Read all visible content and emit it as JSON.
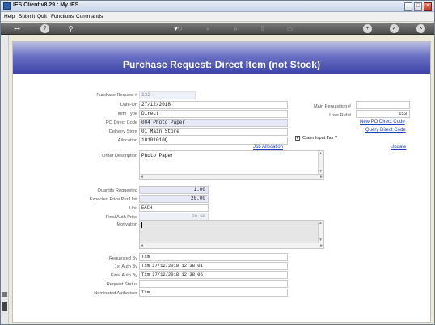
{
  "window": {
    "title": "IES Client v8.29 : My IES",
    "controls": {
      "minimize": "–",
      "maximize": "□",
      "close": "×"
    }
  },
  "menu": [
    "Help",
    "Submit",
    "Quit",
    "Functions",
    "Commands"
  ],
  "toolbar": {
    "icons": [
      "key-icon",
      "help-icon",
      "search-icon",
      "heart-icon",
      "refresh-icon",
      "rewind-icon",
      "forward-icon",
      "upload-icon",
      "page-icon",
      "add-icon",
      "ok-icon",
      "close-icon"
    ],
    "glyphs": {
      "key": "⊶",
      "help": "?",
      "search": "⚲",
      "heart": "♥",
      "refresh": "↻",
      "rewind": "«",
      "forward": "»",
      "upload": "⇧",
      "page": "▭",
      "add": "+",
      "ok": "✓",
      "close": "×"
    }
  },
  "page": {
    "title": "Purchase Request: Direct Item (not Stock)",
    "colors": {
      "banner_top": "#b9bde3",
      "banner_bottom": "#3e44a5",
      "link": "#1a3fbf"
    }
  },
  "form": {
    "purchase_request_no": {
      "label": "Purchase Request #",
      "value": "132"
    },
    "date_on": {
      "label": "Date-On",
      "value": "27/12/2018"
    },
    "item_type": {
      "label": "Item Type",
      "value": "Direct"
    },
    "po_direct_code": {
      "label": "PO Direct Code",
      "value": "004 Photo Paper"
    },
    "delivery_store": {
      "label": "Delivery Store",
      "value": "01 Main Store"
    },
    "allocation": {
      "label": "Allocation",
      "value": "10101010Q"
    },
    "main_requisition": {
      "label": "Main Requisition #",
      "value": ""
    },
    "user_ref": {
      "label": "User Ref #",
      "value": "153"
    },
    "claim_input_tax": {
      "label": "Claim Input Tax ?",
      "checked": true,
      "mark": "✓"
    },
    "order_description": {
      "label": "Order Description",
      "value": "Photo Paper"
    },
    "quantity_requested": {
      "label": "Quantity Requested",
      "value": "1.00"
    },
    "expected_price": {
      "label": "Expected Price Per Unit",
      "value": "20.00"
    },
    "unit": {
      "label": "Unit",
      "value": "EACH"
    },
    "final_auth_price": {
      "label": "Final Auth Price",
      "value": "20.00"
    },
    "motivation": {
      "label": "Motivation",
      "value": ""
    },
    "requested_by": {
      "label": "Requested By",
      "value": "Tim"
    },
    "first_auth_by": {
      "label": "1st Auth By",
      "value": "Tim 27/12/2018 12:38:01"
    },
    "final_auth_by": {
      "label": "Final Auth By",
      "value": "Tim 27/12/2018 12:38:05"
    },
    "request_status": {
      "label": "Request Status",
      "value": ""
    },
    "nominated_authoriser": {
      "label": "Nominated Authoriser",
      "value": "Tim"
    }
  },
  "links": {
    "new_po_direct_code": "New PO Direct Code",
    "query_direct_code": "Query Direct Code",
    "job_allocation": "Job Allocation",
    "update": "Update"
  },
  "scroll_glyphs": {
    "left": "◄",
    "right": "►",
    "up": "▲",
    "down": "▼"
  }
}
